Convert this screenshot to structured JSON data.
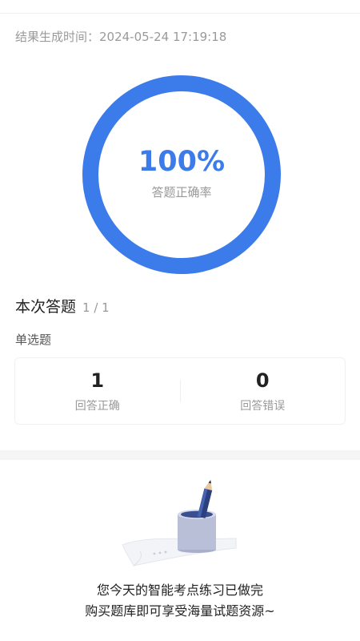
{
  "result": {
    "generated_time": "结果生成时间：2024-05-24 17:19:18",
    "accuracy_value": "100%",
    "accuracy_label": "答题正确率",
    "accuracy_fraction": 1.0
  },
  "summary": {
    "title": "本次答题",
    "count": "1 / 1"
  },
  "question_type": "单选题",
  "stats": {
    "correct_value": "1",
    "correct_label": "回答正确",
    "wrong_value": "0",
    "wrong_label": "回答错误"
  },
  "promo": {
    "line1": "您今天的智能考点练习已做完",
    "line2": "购买题库即可享受海量试题资源~"
  },
  "colors": {
    "accent": "#3c7bea",
    "track": "#e6eefc"
  },
  "icons": {
    "illustration": "pencil-cup-illustration"
  }
}
